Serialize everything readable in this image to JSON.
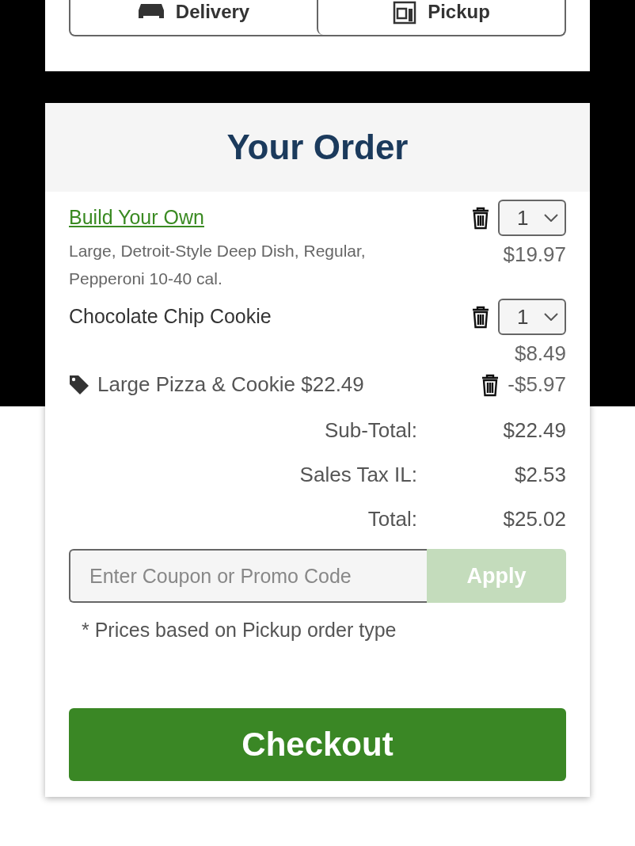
{
  "order_type": {
    "options": [
      {
        "label": "Delivery",
        "kind": "delivery",
        "selected": false
      },
      {
        "label": "Pickup",
        "kind": "pickup",
        "selected": false
      }
    ]
  },
  "order": {
    "title": "Your Order",
    "items": [
      {
        "name": "Build Your Own",
        "link": true,
        "details": "Large, Detroit-Style Deep Dish, Regular, Pepperoni 10-40 cal.",
        "quantity": "1",
        "price": "$19.97"
      },
      {
        "name": "Chocolate Chip Cookie",
        "link": false,
        "quantity": "1",
        "price": "$8.49"
      }
    ],
    "discount": {
      "label": "Large Pizza & Cookie $22.49",
      "amount": "-$5.97"
    },
    "totals": [
      {
        "label": "Sub-Total:",
        "value": "$22.49"
      },
      {
        "label": "Sales Tax IL:",
        "value": "$2.53"
      },
      {
        "label": "Total:",
        "value": "$25.02"
      }
    ],
    "coupon": {
      "placeholder": "Enter Coupon or Promo Code",
      "button": "Apply",
      "disabled": true
    },
    "note": "* Prices based on Pickup order type",
    "checkout": "Checkout"
  }
}
